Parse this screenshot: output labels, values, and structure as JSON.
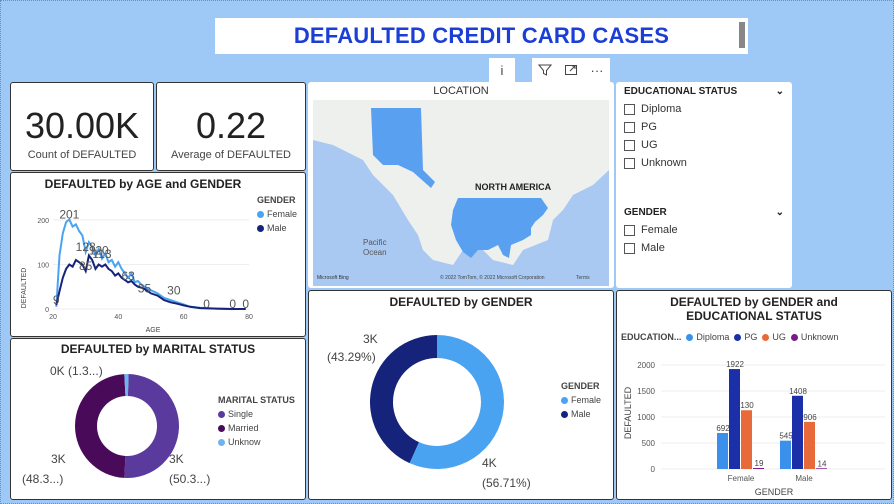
{
  "header": {
    "title": "DEFAULTED CREDIT CARD CASES"
  },
  "toolbar": {
    "info_glyph": "i",
    "filter_icon": "filter-icon",
    "focus_icon": "expand-icon",
    "more_glyph": "···"
  },
  "kpis": [
    {
      "value": "30.00K",
      "label": "Count of DEFAULTED"
    },
    {
      "value": "0.22",
      "label": "Average of DEFAULTED"
    }
  ],
  "map": {
    "title": "LOCATION",
    "continent_label": "NORTH AMERICA",
    "ocean_label_1": "Pacific",
    "ocean_label_2": "Ocean",
    "logo": "Microsoft Bing",
    "credit": "© 2022 TomTom, © 2022 Microsoft Corporation",
    "terms": "Terms",
    "land_color": "#eef0ee",
    "water_color": "#a9c9f2",
    "highlight_color": "#5aa0f0"
  },
  "slicers": {
    "education": {
      "title": "EDUCATIONAL STATUS",
      "options": [
        "Diploma",
        "PG",
        "UG",
        "Unknown"
      ]
    },
    "gender": {
      "title": "GENDER",
      "options": [
        "Female",
        "Male"
      ]
    }
  },
  "colors": {
    "female": "#4aa3f0",
    "male": "#15237a",
    "single": "#5b3a9e",
    "married": "#4a0a5a",
    "unknown": "#6fb3f0",
    "ug": "#e86a3a",
    "pg": "#1a2fa8",
    "diploma": "#3a90ea",
    "unk_edu": "#7a1a8a"
  },
  "chart_data": [
    {
      "type": "line",
      "title": "DEFAULTED by AGE and GENDER",
      "xlabel": "AGE",
      "ylabel": "DEFAULTED",
      "xlim": [
        20,
        80
      ],
      "ylim": [
        0,
        220
      ],
      "x_ticks": [
        "20",
        "40",
        "60",
        "80"
      ],
      "y_ticks": [
        "0",
        "100",
        "200"
      ],
      "legend_title": "GENDER",
      "series": [
        {
          "name": "Female",
          "x": [
            21,
            22,
            23,
            24,
            25,
            26,
            27,
            28,
            29,
            30,
            31,
            32,
            33,
            34,
            35,
            36,
            37,
            38,
            39,
            40,
            41,
            42,
            43,
            44,
            45,
            46,
            47,
            48,
            49,
            50,
            52,
            54,
            56,
            58,
            60,
            62,
            65,
            70,
            75,
            79
          ],
          "values": [
            5,
            120,
            170,
            195,
            201,
            185,
            190,
            175,
            165,
            128,
            150,
            140,
            120,
            135,
            113,
            125,
            105,
            110,
            95,
            105,
            90,
            80,
            70,
            80,
            60,
            63,
            55,
            50,
            45,
            42,
            35,
            25,
            20,
            15,
            10,
            5,
            3,
            1,
            0,
            0
          ]
        },
        {
          "name": "Male",
          "x": [
            21,
            22,
            23,
            24,
            25,
            26,
            27,
            28,
            29,
            30,
            31,
            32,
            33,
            34,
            35,
            36,
            37,
            38,
            39,
            40,
            41,
            42,
            43,
            44,
            45,
            46,
            47,
            48,
            49,
            50,
            52,
            54,
            56,
            58,
            60,
            62,
            65,
            70,
            75,
            79
          ],
          "values": [
            9,
            40,
            70,
            90,
            100,
            95,
            110,
            105,
            100,
            85,
            120,
            110,
            90,
            100,
            95,
            100,
            90,
            85,
            75,
            80,
            70,
            65,
            60,
            63,
            55,
            50,
            48,
            45,
            40,
            35,
            30,
            20,
            15,
            12,
            8,
            5,
            2,
            1,
            0,
            0
          ]
        }
      ],
      "data_labels": [
        "201",
        "128",
        "113",
        "85",
        "120",
        "63",
        "35",
        "30",
        "9",
        "0",
        "0",
        "0"
      ]
    },
    {
      "type": "pie",
      "title": "DEFAULTED by MARITAL STATUS",
      "legend_title": "MARITAL STATUS",
      "labels": [
        "Single",
        "Married",
        "Unknow"
      ],
      "values": [
        50.3,
        48.3,
        1.3
      ],
      "data_labels": [
        "3K",
        "(50.3...)",
        "3K",
        "(48.3...)",
        "0K (1.3...)"
      ]
    },
    {
      "type": "pie",
      "title": "DEFAULTED by GENDER",
      "legend_title": "GENDER",
      "labels": [
        "Female",
        "Male"
      ],
      "values": [
        56.71,
        43.29
      ],
      "data_labels": [
        "4K",
        "(56.71%)",
        "3K",
        "(43.29%)"
      ]
    },
    {
      "type": "bar",
      "title": "DEFAULTED by GENDER and EDUCATIONAL STATUS",
      "xlabel": "GENDER",
      "ylabel": "DEFAULTED",
      "legend_title": "EDUCATION...",
      "categories": [
        "Female",
        "Male"
      ],
      "ylim": [
        0,
        2000
      ],
      "y_ticks": [
        "0",
        "500",
        "1000",
        "1500",
        "2000"
      ],
      "series": [
        {
          "name": "Diploma",
          "values": [
            692,
            545
          ]
        },
        {
          "name": "PG",
          "values": [
            1922,
            1408
          ]
        },
        {
          "name": "UG",
          "values": [
            1130,
            906
          ]
        },
        {
          "name": "Unknown",
          "values": [
            19,
            14
          ]
        }
      ],
      "data_labels": [
        "692",
        "1922",
        "130",
        "19",
        "545",
        "1408",
        "906",
        "14"
      ]
    }
  ]
}
